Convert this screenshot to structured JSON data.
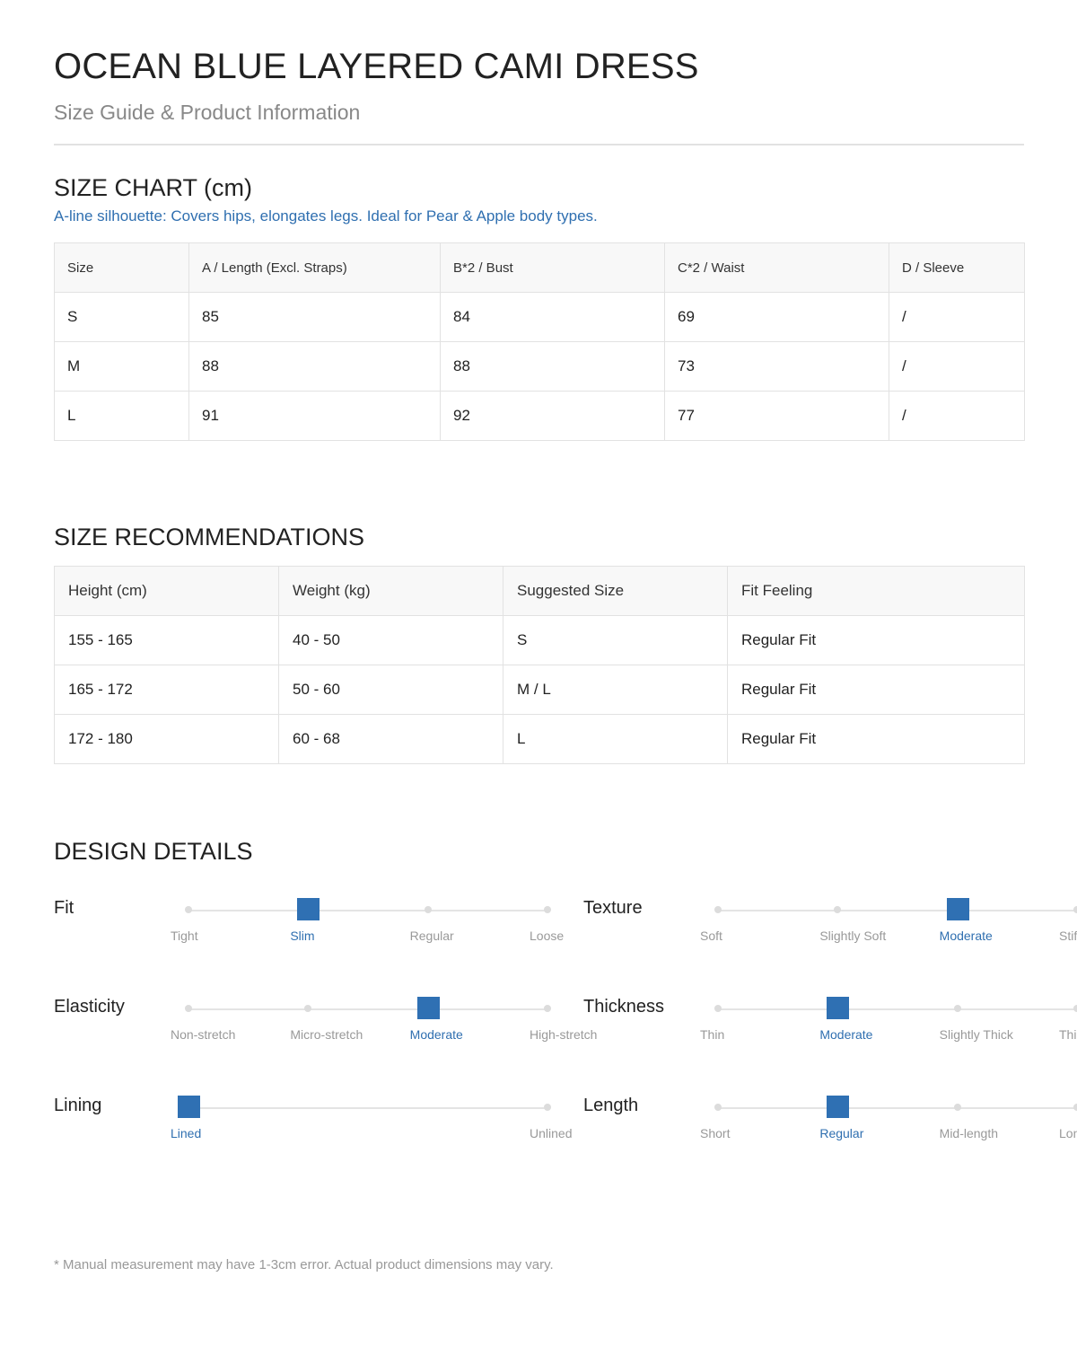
{
  "header": {
    "title": "OCEAN BLUE LAYERED CAMI DRESS",
    "subtitle": "Size Guide & Product Information"
  },
  "size_chart": {
    "title": "SIZE CHART (cm)",
    "note": "A-line silhouette: Covers hips, elongates legs. Ideal for Pear & Apple body types.",
    "columns": [
      "Size",
      "A / Length (Excl. Straps)",
      "B*2 / Bust",
      "C*2 / Waist",
      "D / Sleeve"
    ],
    "rows": [
      [
        "S",
        "85",
        "84",
        "69",
        "/"
      ],
      [
        "M",
        "88",
        "88",
        "73",
        "/"
      ],
      [
        "L",
        "91",
        "92",
        "77",
        "/"
      ]
    ]
  },
  "recommendations": {
    "title": "SIZE RECOMMENDATIONS",
    "columns": [
      "Height (cm)",
      "Weight (kg)",
      "Suggested Size",
      "Fit Feeling"
    ],
    "rows": [
      [
        "155 - 165",
        "40 - 50",
        "S",
        "Regular Fit"
      ],
      [
        "165 - 172",
        "50 - 60",
        "M / L",
        "Regular Fit"
      ],
      [
        "172 - 180",
        "60 - 68",
        "L",
        "Regular Fit"
      ]
    ]
  },
  "design_details": {
    "title": "DESIGN DETAILS",
    "accent_color": "#2f70b3",
    "items": [
      {
        "label": "Fit",
        "options": [
          "Tight",
          "Slim",
          "Regular",
          "Loose"
        ],
        "selected": 1
      },
      {
        "label": "Texture",
        "options": [
          "Soft",
          "Slightly Soft",
          "Moderate",
          "Stiff"
        ],
        "selected": 2
      },
      {
        "label": "Elasticity",
        "options": [
          "Non-stretch",
          "Micro-stretch",
          "Moderate",
          "High-stretch"
        ],
        "selected": 2
      },
      {
        "label": "Thickness",
        "options": [
          "Thin",
          "Moderate",
          "Slightly Thick",
          "Thick"
        ],
        "selected": 1
      },
      {
        "label": "Lining",
        "options": [
          "Lined",
          "Unlined"
        ],
        "selected": 0
      },
      {
        "label": "Length",
        "options": [
          "Short",
          "Regular",
          "Mid-length",
          "Long"
        ],
        "selected": 1
      }
    ]
  },
  "footnote": "* Manual measurement may have 1-3cm error. Actual product dimensions may vary."
}
